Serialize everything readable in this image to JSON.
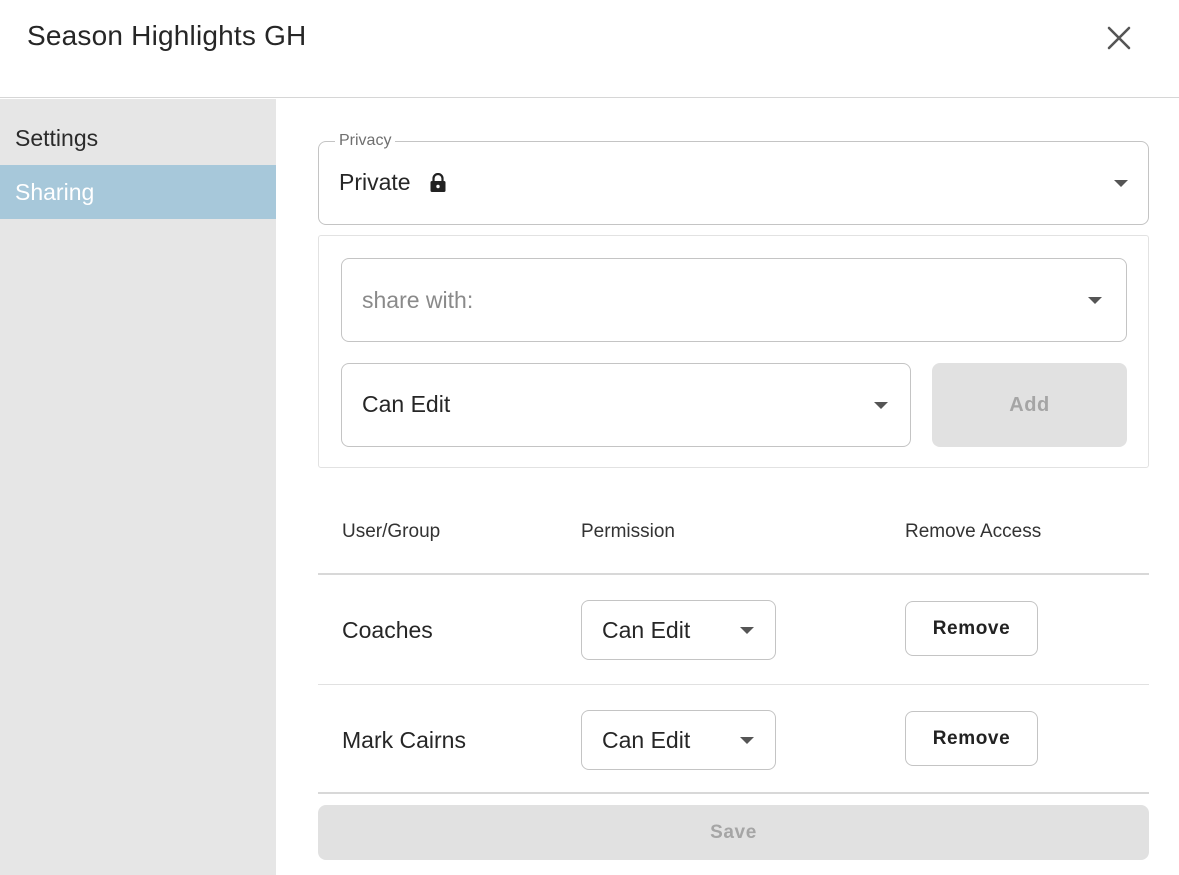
{
  "dialog": {
    "title": "Season Highlights GH",
    "close_icon": "close-icon"
  },
  "sidebar": {
    "items": [
      {
        "label": "Settings",
        "active": false
      },
      {
        "label": "Sharing",
        "active": true
      }
    ],
    "active_color": "#a7c8da"
  },
  "privacy": {
    "legend": "Privacy",
    "value": "Private",
    "icon": "lock-icon"
  },
  "share": {
    "placeholder": "share with:",
    "permission_value": "Can Edit",
    "add_label": "Add"
  },
  "table": {
    "headers": [
      "User/Group",
      "Permission",
      "Remove Access"
    ],
    "rows": [
      {
        "name": "Coaches",
        "permission": "Can Edit",
        "remove_label": "Remove"
      },
      {
        "name": "Mark Cairns",
        "permission": "Can Edit",
        "remove_label": "Remove"
      }
    ]
  },
  "footer": {
    "save_label": "Save"
  }
}
